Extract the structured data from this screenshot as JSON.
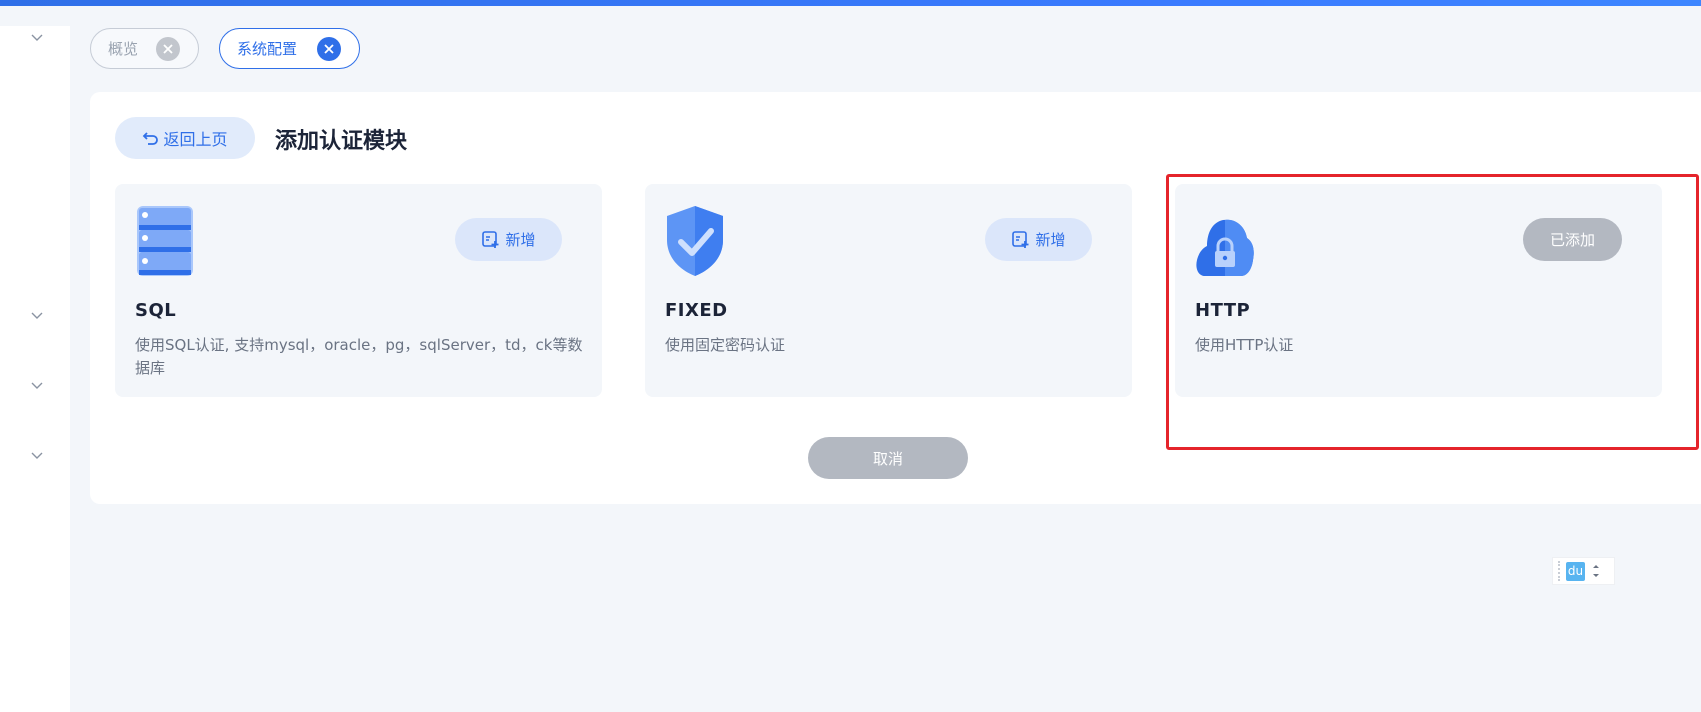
{
  "tabs": [
    {
      "label": "概览",
      "active": false
    },
    {
      "label": "系统配置",
      "active": true
    }
  ],
  "header": {
    "back_label": "返回上页",
    "title": "添加认证模块"
  },
  "modules": [
    {
      "icon": "database-server-icon",
      "name": "SQL",
      "description": "使用SQL认证, 支持mysql，oracle，pg，sqlServer，td，ck等数据库",
      "action_label": "新增",
      "status": "available"
    },
    {
      "icon": "shield-check-icon",
      "name": "FIXED",
      "description": "使用固定密码认证",
      "action_label": "新增",
      "status": "available"
    },
    {
      "icon": "cloud-lock-icon",
      "name": "HTTP",
      "description": "使用HTTP认证",
      "action_label": "已添加",
      "status": "added"
    }
  ],
  "footer": {
    "cancel_label": "取消"
  },
  "ime": {
    "label": "du"
  },
  "colors": {
    "primary": "#2f6fe8",
    "disabled": "#b3b8c1",
    "highlight": "#e5242b"
  }
}
